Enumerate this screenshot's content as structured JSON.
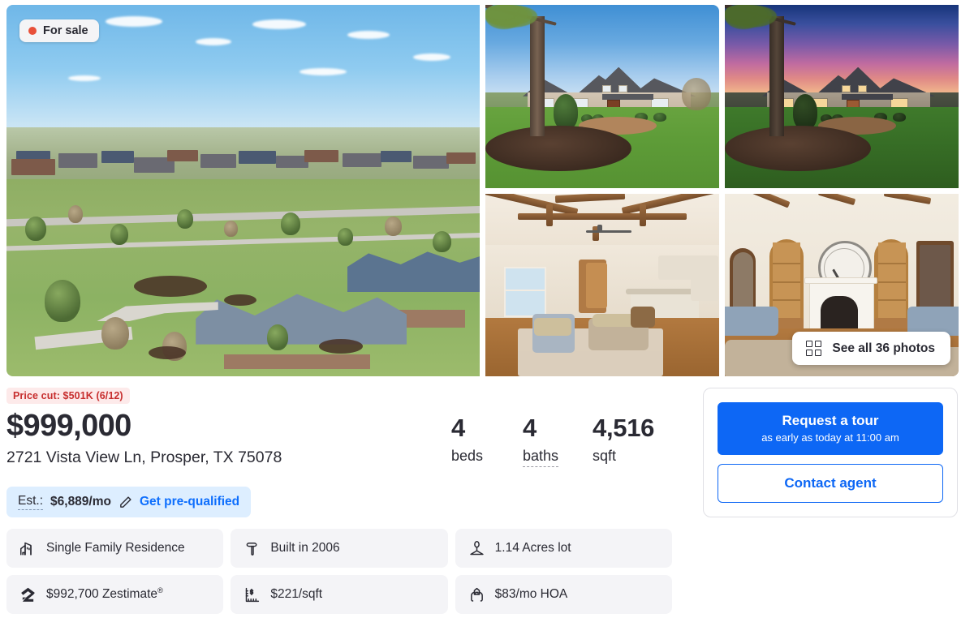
{
  "gallery": {
    "for_sale_badge": "For sale",
    "all_photos_button": "See all 36 photos",
    "photo_count": 36,
    "photos": [
      {
        "name": "aerial-neighborhood-view",
        "alt": "Aerial view of home and golf course neighborhood"
      },
      {
        "name": "front-exterior-day",
        "alt": "Front exterior daytime with large oak tree"
      },
      {
        "name": "front-exterior-twilight",
        "alt": "Front exterior at twilight with pink purple sky"
      },
      {
        "name": "living-room-beamed-ceiling",
        "alt": "Living room with coffered wood beam ceiling"
      },
      {
        "name": "family-room-fireplace",
        "alt": "Family room with fireplace, clock and built-in shelves"
      }
    ]
  },
  "listing": {
    "price_cut": "Price cut: $501K (6/12)",
    "price": "$999,000",
    "address": "2721 Vista View Ln, Prosper, TX 75078",
    "beds_value": "4",
    "beds_label": "beds",
    "baths_value": "4",
    "baths_label": "baths",
    "sqft_value": "4,516",
    "sqft_label": "sqft"
  },
  "prequal": {
    "est_label": "Est.:",
    "amount": "$6,889/mo",
    "link": "Get pre-qualified"
  },
  "facts": [
    {
      "icon": "home-building-icon",
      "text": "Single Family Residence"
    },
    {
      "icon": "hammer-icon",
      "text": "Built in 2006"
    },
    {
      "icon": "lot-tree-icon",
      "text": "1.14 Acres lot"
    },
    {
      "icon": "zillow-z-icon",
      "text": "$992,700 Zestimate",
      "sup": "®"
    },
    {
      "icon": "ruler-dollar-icon",
      "text": "$221/sqft"
    },
    {
      "icon": "hands-house-icon",
      "text": "$83/mo HOA"
    }
  ],
  "cta": {
    "tour_title": "Request a tour",
    "tour_subtitle": "as early as today at 11:00 am",
    "contact_label": "Contact agent"
  },
  "colors": {
    "accent_blue": "#0d67f5",
    "price_cut_red": "#c72e2e",
    "price_cut_bg": "#fdeaea",
    "for_sale_dot": "#e8503a",
    "fact_bg": "#f4f4f7",
    "prequal_bg": "#ddeeff",
    "text": "#2a2a33"
  }
}
